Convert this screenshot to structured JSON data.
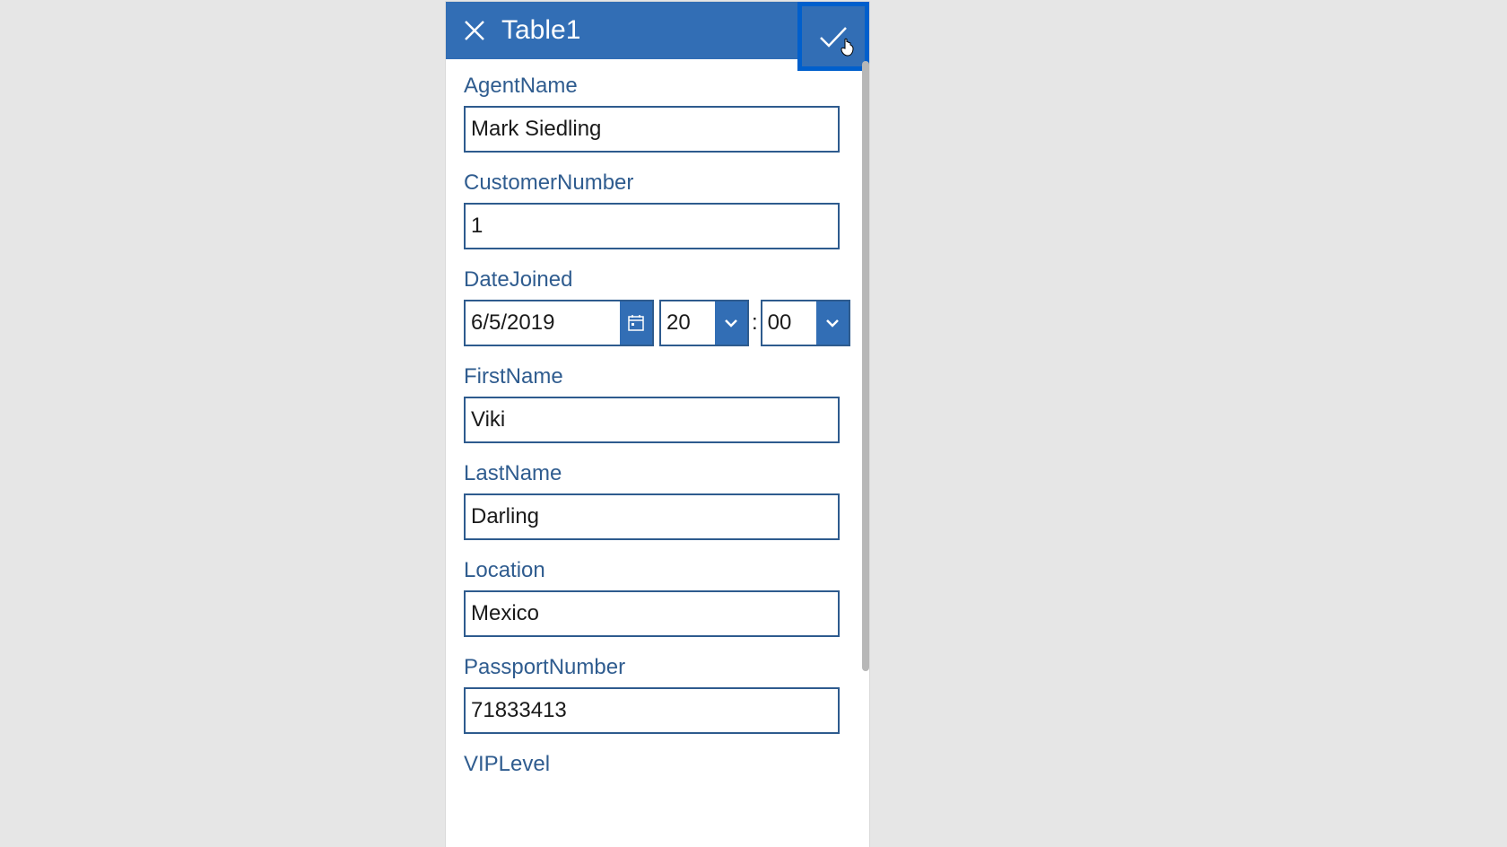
{
  "header": {
    "title": "Table1"
  },
  "fields": {
    "agentName": {
      "label": "AgentName",
      "value": "Mark Siedling"
    },
    "customerNumber": {
      "label": "CustomerNumber",
      "value": "1"
    },
    "dateJoined": {
      "label": "DateJoined",
      "date": "6/5/2019",
      "hour": "20",
      "minute": "00",
      "separator": ":"
    },
    "firstName": {
      "label": "FirstName",
      "value": "Viki"
    },
    "lastName": {
      "label": "LastName",
      "value": "Darling"
    },
    "location": {
      "label": "Location",
      "value": "Mexico"
    },
    "passportNumber": {
      "label": "PassportNumber",
      "value": "71833413"
    },
    "vipLevel": {
      "label": "VIPLevel",
      "value": ""
    }
  }
}
